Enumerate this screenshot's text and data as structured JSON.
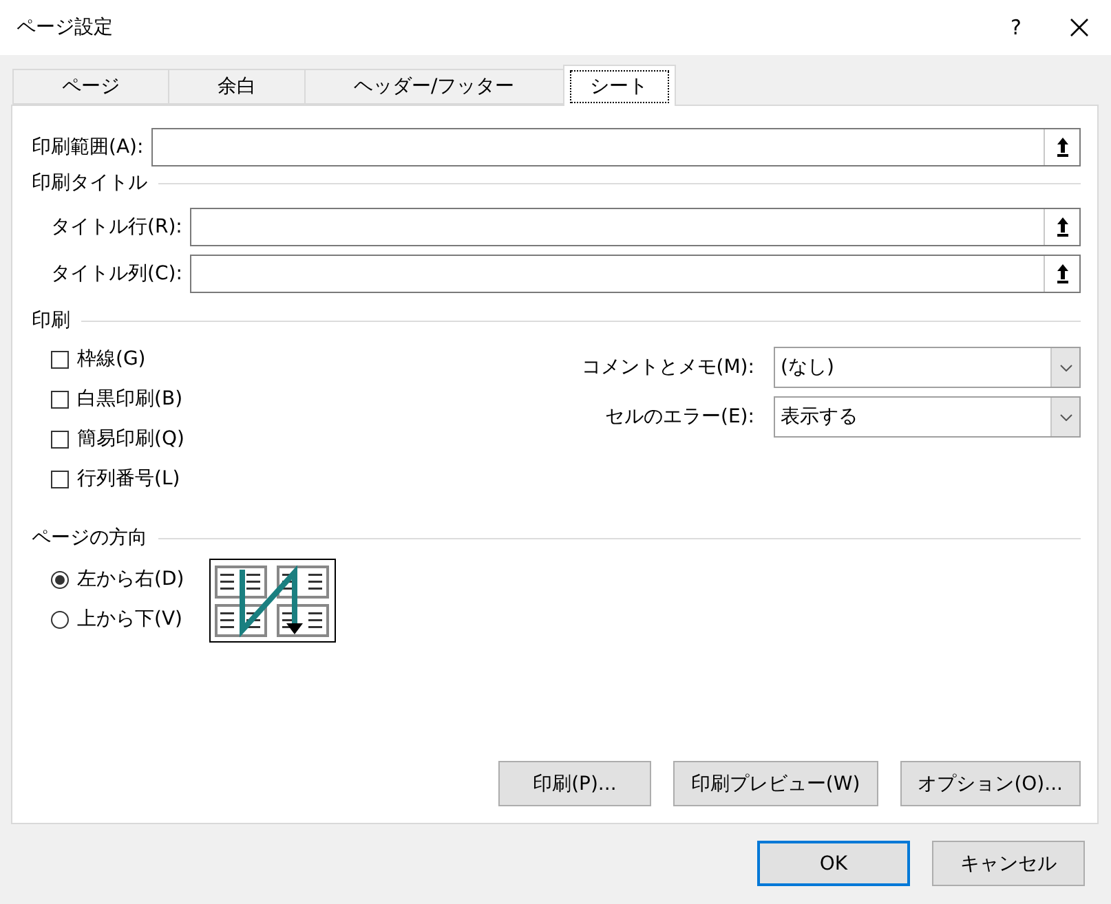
{
  "window": {
    "title": "ページ設定",
    "help_button": "?"
  },
  "tabs": [
    {
      "label": "ページ",
      "selected": false
    },
    {
      "label": "余白",
      "selected": false
    },
    {
      "label": "ヘッダー/フッター",
      "selected": false
    },
    {
      "label": "シート",
      "selected": true
    }
  ],
  "print_area": {
    "label": "印刷範囲(A):"
  },
  "print_titles": {
    "heading": "印刷タイトル",
    "fields": [
      {
        "label": "タイトル行(R):"
      },
      {
        "label": "タイトル列(C):"
      }
    ]
  },
  "print": {
    "heading": "印刷",
    "options": [
      {
        "label": "枠線(G)",
        "checked": false
      },
      {
        "label": "白黒印刷(B)",
        "checked": false
      },
      {
        "label": "簡易印刷(Q)",
        "checked": false
      },
      {
        "label": "行列番号(L)",
        "checked": false
      }
    ],
    "dropdowns": [
      {
        "label": "コメントとメモ(M):",
        "value": "(なし)"
      },
      {
        "label": "セルのエラー(E):",
        "value": "表示する"
      }
    ]
  },
  "page_order": {
    "heading": "ページの方向",
    "options": [
      {
        "label": "左から右(D)",
        "selected": true
      },
      {
        "label": "上から下(V)",
        "selected": false
      }
    ]
  },
  "panel_buttons": [
    "印刷(P)...",
    "印刷プレビュー(W)",
    "オプション(O)..."
  ],
  "buttons": [
    {
      "label": "OK",
      "default": true
    },
    {
      "label": "キャンセル",
      "default": false
    }
  ]
}
